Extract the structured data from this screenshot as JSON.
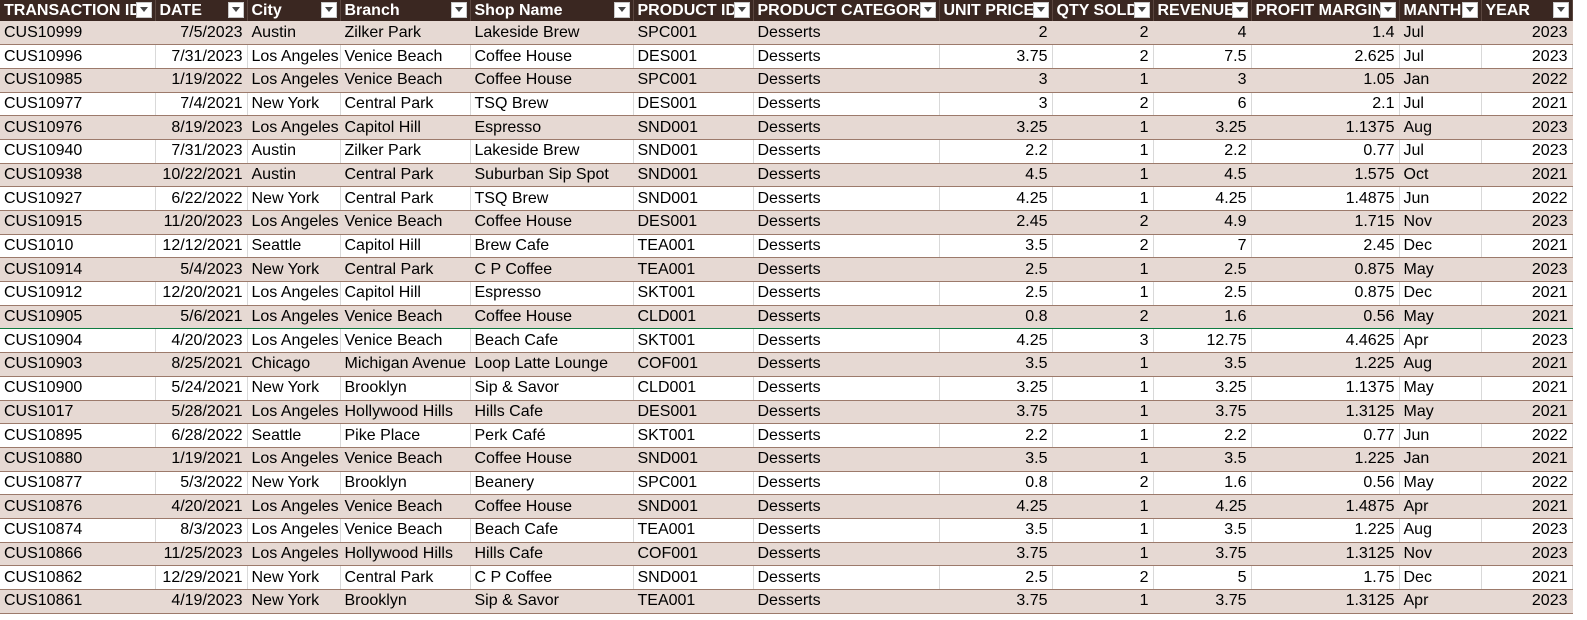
{
  "columns": [
    {
      "key": "id",
      "label": "TRANSACTION ID",
      "align": "txt"
    },
    {
      "key": "date",
      "label": "DATE",
      "align": "num"
    },
    {
      "key": "city",
      "label": "City",
      "align": "txt"
    },
    {
      "key": "branch",
      "label": "Branch",
      "align": "txt"
    },
    {
      "key": "shop",
      "label": "Shop Name",
      "align": "txt"
    },
    {
      "key": "product_id",
      "label": "PRODUCT ID",
      "align": "txt"
    },
    {
      "key": "category",
      "label": "PRODUCT CATEGORY",
      "align": "txt"
    },
    {
      "key": "unit_price",
      "label": "UNIT PRICE",
      "align": "num"
    },
    {
      "key": "qty",
      "label": "QTY SOLD",
      "align": "num"
    },
    {
      "key": "revenue",
      "label": "REVENUE",
      "align": "num"
    },
    {
      "key": "profit",
      "label": "PROFIT MARGIN",
      "align": "num"
    },
    {
      "key": "month",
      "label": "MANTH",
      "align": "txt"
    },
    {
      "key": "year",
      "label": "YEAR",
      "align": "num"
    }
  ],
  "filter_icon": "filter-dropdown-icon",
  "colors": {
    "header_bg": "#3a2721",
    "band_odd": "#e6d9d3",
    "band_even": "#ffffff",
    "row_border": "#9c7a6b"
  },
  "rows": [
    [
      "CUS10999",
      "7/5/2023",
      "Austin",
      "Zilker Park",
      "Lakeside Brew",
      "SPC001",
      "Desserts",
      "2",
      "2",
      "4",
      "1.4",
      "Jul",
      "2023"
    ],
    [
      "CUS10996",
      "7/31/2023",
      "Los Angeles",
      "Venice Beach",
      "Coffee House",
      "DES001",
      "Desserts",
      "3.75",
      "2",
      "7.5",
      "2.625",
      "Jul",
      "2023"
    ],
    [
      "CUS10985",
      "1/19/2022",
      "Los Angeles",
      "Venice Beach",
      "Coffee House",
      "SPC001",
      "Desserts",
      "3",
      "1",
      "3",
      "1.05",
      "Jan",
      "2022"
    ],
    [
      "CUS10977",
      "7/4/2021",
      "New York",
      "Central Park",
      "TSQ Brew",
      "DES001",
      "Desserts",
      "3",
      "2",
      "6",
      "2.1",
      "Jul",
      "2021"
    ],
    [
      "CUS10976",
      "8/19/2023",
      "Los Angeles",
      "Capitol Hill",
      "Espresso",
      "SND001",
      "Desserts",
      "3.25",
      "1",
      "3.25",
      "1.1375",
      "Aug",
      "2023"
    ],
    [
      "CUS10940",
      "7/31/2023",
      "Austin",
      "Zilker Park",
      "Lakeside Brew",
      "SND001",
      "Desserts",
      "2.2",
      "1",
      "2.2",
      "0.77",
      "Jul",
      "2023"
    ],
    [
      "CUS10938",
      "10/22/2021",
      "Austin",
      "Central Park",
      "Suburban Sip Spot",
      "SND001",
      "Desserts",
      "4.5",
      "1",
      "4.5",
      "1.575",
      "Oct",
      "2021"
    ],
    [
      "CUS10927",
      "6/22/2022",
      "New York",
      "Central Park",
      "TSQ Brew",
      "SND001",
      "Desserts",
      "4.25",
      "1",
      "4.25",
      "1.4875",
      "Jun",
      "2022"
    ],
    [
      "CUS10915",
      "11/20/2023",
      "Los Angeles",
      "Venice Beach",
      "Coffee House",
      "DES001",
      "Desserts",
      "2.45",
      "2",
      "4.9",
      "1.715",
      "Nov",
      "2023"
    ],
    [
      "CUS1010",
      "12/12/2021",
      "Seattle",
      "Capitol Hill",
      "Brew Cafe",
      "TEA001",
      "Desserts",
      "3.5",
      "2",
      "7",
      "2.45",
      "Dec",
      "2021"
    ],
    [
      "CUS10914",
      "5/4/2023",
      "New York",
      "Central Park",
      "C P Coffee",
      "TEA001",
      "Desserts",
      "2.5",
      "1",
      "2.5",
      "0.875",
      "May",
      "2023"
    ],
    [
      "CUS10912",
      "12/20/2021",
      "Los Angeles",
      "Capitol Hill",
      "Espresso",
      "SKT001",
      "Desserts",
      "2.5",
      "1",
      "2.5",
      "0.875",
      "Dec",
      "2021"
    ],
    [
      "CUS10905",
      "5/6/2021",
      "Los Angeles",
      "Venice Beach",
      "Coffee House",
      "CLD001",
      "Desserts",
      "0.8",
      "2",
      "1.6",
      "0.56",
      "May",
      "2021"
    ],
    [
      "CUS10904",
      "4/20/2023",
      "Los Angeles",
      "Venice Beach",
      "Beach Cafe",
      "SKT001",
      "Desserts",
      "4.25",
      "3",
      "12.75",
      "4.4625",
      "Apr",
      "2023"
    ],
    [
      "CUS10903",
      "8/25/2021",
      "Chicago",
      "Michigan Avenue",
      "Loop Latte Lounge",
      "COF001",
      "Desserts",
      "3.5",
      "1",
      "3.5",
      "1.225",
      "Aug",
      "2021"
    ],
    [
      "CUS10900",
      "5/24/2021",
      "New York",
      "Brooklyn",
      "Sip & Savor",
      "CLD001",
      "Desserts",
      "3.25",
      "1",
      "3.25",
      "1.1375",
      "May",
      "2021"
    ],
    [
      "CUS1017",
      "5/28/2021",
      "Los Angeles",
      "Hollywood Hills",
      "Hills Cafe",
      "DES001",
      "Desserts",
      "3.75",
      "1",
      "3.75",
      "1.3125",
      "May",
      "2021"
    ],
    [
      "CUS10895",
      "6/28/2022",
      "Seattle",
      "Pike Place",
      "Perk Café",
      "SKT001",
      "Desserts",
      "2.2",
      "1",
      "2.2",
      "0.77",
      "Jun",
      "2022"
    ],
    [
      "CUS10880",
      "1/19/2021",
      "Los Angeles",
      "Venice Beach",
      "Coffee House",
      "SND001",
      "Desserts",
      "3.5",
      "1",
      "3.5",
      "1.225",
      "Jan",
      "2021"
    ],
    [
      "CUS10877",
      "5/3/2022",
      "New York",
      "Brooklyn",
      "Beanery",
      "SPC001",
      "Desserts",
      "0.8",
      "2",
      "1.6",
      "0.56",
      "May",
      "2022"
    ],
    [
      "CUS10876",
      "4/20/2021",
      "Los Angeles",
      "Venice Beach",
      "Coffee House",
      "SND001",
      "Desserts",
      "4.25",
      "1",
      "4.25",
      "1.4875",
      "Apr",
      "2021"
    ],
    [
      "CUS10874",
      "8/3/2023",
      "Los Angeles",
      "Venice Beach",
      "Beach Cafe",
      "TEA001",
      "Desserts",
      "3.5",
      "1",
      "3.5",
      "1.225",
      "Aug",
      "2023"
    ],
    [
      "CUS10866",
      "11/25/2023",
      "Los Angeles",
      "Hollywood Hills",
      "Hills Cafe",
      "COF001",
      "Desserts",
      "3.75",
      "1",
      "3.75",
      "1.3125",
      "Nov",
      "2023"
    ],
    [
      "CUS10862",
      "12/29/2021",
      "New York",
      "Central Park",
      "C P Coffee",
      "SND001",
      "Desserts",
      "2.5",
      "2",
      "5",
      "1.75",
      "Dec",
      "2021"
    ],
    [
      "CUS10861",
      "4/19/2023",
      "New York",
      "Brooklyn",
      "Sip & Savor",
      "TEA001",
      "Desserts",
      "3.75",
      "1",
      "3.75",
      "1.3125",
      "Apr",
      "2023"
    ]
  ]
}
